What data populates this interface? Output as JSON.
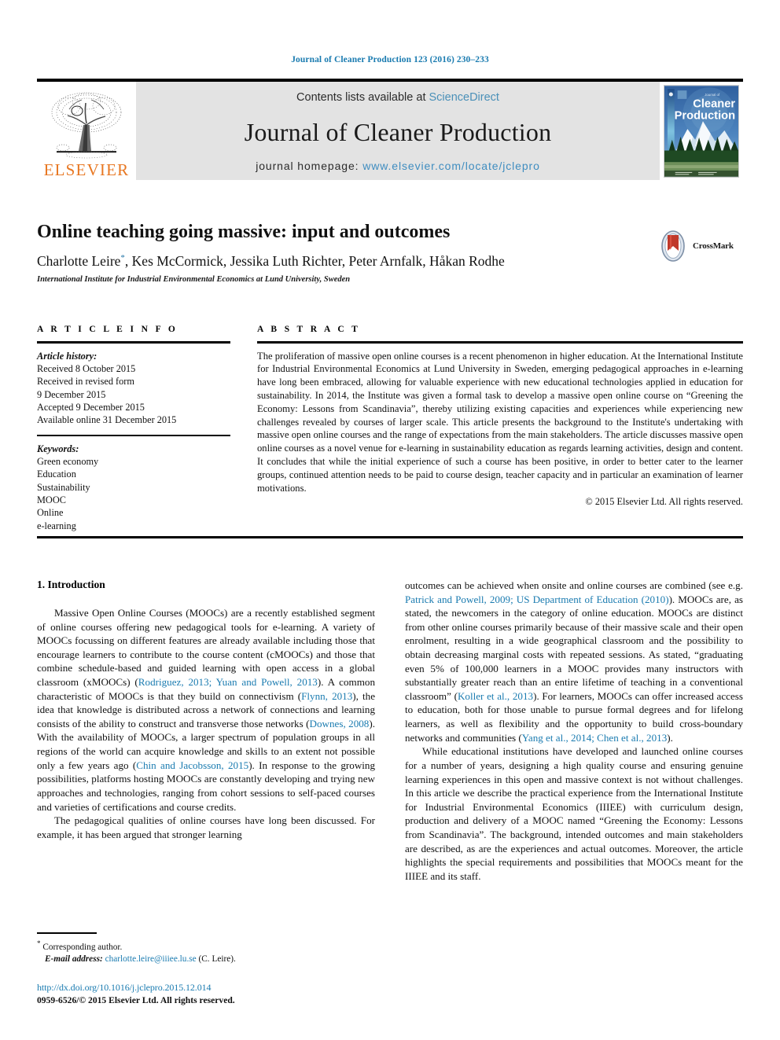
{
  "running_head": "Journal of Cleaner Production 123 (2016) 230–233",
  "masthead": {
    "publisher_name": "ELSEVIER",
    "contents_prefix": "Contents lists available at ",
    "contents_link": "ScienceDirect",
    "journal_title": "Journal of Cleaner Production",
    "homepage_prefix": "journal homepage: ",
    "homepage_link": "www.elsevier.com/locate/jclepro",
    "cover_title_small": "Journal of",
    "cover_title_line1": "Cleaner",
    "cover_title_line2": "Production"
  },
  "article": {
    "title": "Online teaching going massive: input and outcomes",
    "authors": "Charlotte Leire",
    "authors_rest": ", Kes McCormick, Jessika Luth Richter, Peter Arnfalk, Håkan Rodhe",
    "corresponding_marker": "*",
    "affiliation": "International Institute for Industrial Environmental Economics at Lund University, Sweden",
    "crossmark_label": "CrossMark"
  },
  "info": {
    "heading": "A R T I C L E   I N F O",
    "history_label": "Article history:",
    "history": [
      "Received 8 October 2015",
      "Received in revised form",
      "9 December 2015",
      "Accepted 9 December 2015",
      "Available online 31 December 2015"
    ],
    "keywords_label": "Keywords:",
    "keywords": [
      "Green economy",
      "Education",
      "Sustainability",
      "MOOC",
      "Online",
      "e-learning"
    ]
  },
  "abstract": {
    "heading": "A B S T R A C T",
    "body": "The proliferation of massive open online courses is a recent phenomenon in higher education. At the International Institute for Industrial Environmental Economics at Lund University in Sweden, emerging pedagogical approaches in e-learning have long been embraced, allowing for valuable experience with new educational technologies applied in education for sustainability. In 2014, the Institute was given a formal task to develop a massive open online course on “Greening the Economy: Lessons from Scandinavia”, thereby utilizing existing capacities and experiences while experiencing new challenges revealed by courses of larger scale. This article presents the background to the Institute's undertaking with massive open online courses and the range of expectations from the main stakeholders. The article discusses massive open online courses as a novel venue for e-learning in sustainability education as regards learning activities, design and content. It concludes that while the initial experience of such a course has been positive, in order to better cater to the learner groups, continued attention needs to be paid to course design, teacher capacity and in particular an examination of learner motivations.",
    "copyright": "© 2015 Elsevier Ltd. All rights reserved."
  },
  "body": {
    "section_heading": "1. Introduction",
    "left_para_1_a": "Massive Open Online Courses (MOOCs) are a recently established segment of online courses offering new pedagogical tools for e-learning. A variety of MOOCs focussing on different features are already available including those that encourage learners to contribute to the course content (cMOOCs) and those that combine schedule-based and guided learning with open access in a global classroom (xMOOCs) (",
    "left_ref_1": "Rodriguez, 2013; Yuan and Powell, 2013",
    "left_para_1_b": "). A common characteristic of MOOCs is that they build on connectivism (",
    "left_ref_2": "Flynn, 2013",
    "left_para_1_c": "), the idea that knowledge is distributed across a network of connections and learning consists of the ability to construct and transverse those networks (",
    "left_ref_3": "Downes, 2008",
    "left_para_1_d": "). With the availability of MOOCs, a larger spectrum of population groups in all regions of the world can acquire knowledge and skills to an extent not possible only a few years ago (",
    "left_ref_4": "Chin and Jacobsson, 2015",
    "left_para_1_e": "). In response to the growing possibilities, platforms hosting MOOCs are constantly developing and trying new approaches and technologies, ranging from cohort sessions to self-paced courses and varieties of certifications and course credits.",
    "left_para_2": "The pedagogical qualities of online courses have long been discussed. For example, it has been argued that stronger learning",
    "right_para_1_a": "outcomes can be achieved when onsite and online courses are combined (see e.g. ",
    "right_ref_1": "Patrick and Powell, 2009; US Department of Education (2010)",
    "right_para_1_b": "). MOOCs are, as stated, the newcomers in the category of online education. MOOCs are distinct from other online courses primarily because of their massive scale and their open enrolment, resulting in a wide geographical classroom and the possibility to obtain decreasing marginal costs with repeated sessions. As stated, “graduating even 5% of 100,000 learners in a MOOC provides many instructors with substantially greater reach than an entire lifetime of teaching in a conventional classroom” (",
    "right_ref_2": "Koller et al., 2013",
    "right_para_1_c": "). For learners, MOOCs can offer increased access to education, both for those unable to pursue formal degrees and for lifelong learners, as well as flexibility and the opportunity to build cross-boundary networks and communities (",
    "right_ref_3": "Yang et al., 2014; Chen et al., 2013",
    "right_para_1_d": ").",
    "right_para_2": "While educational institutions have developed and launched online courses for a number of years, designing a high quality course and ensuring genuine learning experiences in this open and massive context is not without challenges. In this article we describe the practical experience from the International Institute for Industrial Environmental Economics (IIIEE) with curriculum design, production and delivery of a MOOC named “Greening the Economy: Lessons from Scandinavia”. The background, intended outcomes and main stakeholders are described, as are the experiences and actual outcomes. Moreover, the article highlights the special requirements and possibilities that MOOCs meant for the IIIEE and its staff."
  },
  "footnote": {
    "marker": "*",
    "corresponding": " Corresponding author.",
    "email_label": "E-mail address:",
    "email": "charlotte.leire@iiiee.lu.se",
    "email_suffix": " (C. Leire)."
  },
  "footer": {
    "doi": "http://dx.doi.org/10.1016/j.jclepro.2015.12.014",
    "issn_line": "0959-6526/© 2015 Elsevier Ltd. All rights reserved."
  },
  "colors": {
    "link": "#1a7bb0",
    "elsevier_orange": "#E87722",
    "masthead_bg": "#e3e3e3"
  }
}
